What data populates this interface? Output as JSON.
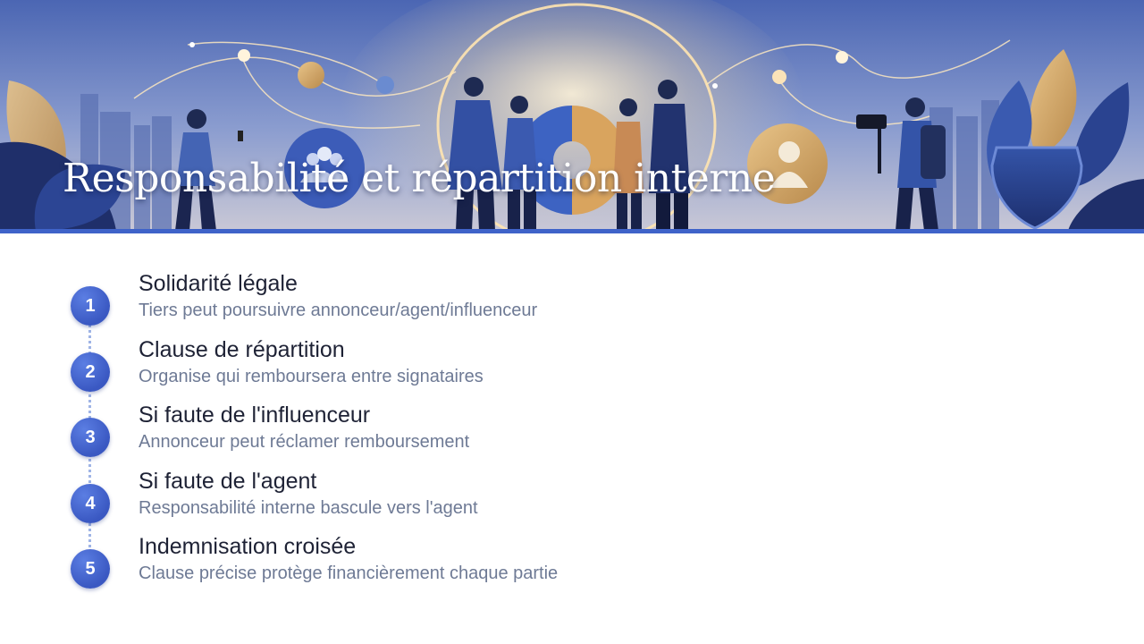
{
  "title": "Responsabilité et répartition interne",
  "accent_color": "#3f63c9",
  "banner": {
    "icons": [
      "group-people-icon",
      "user-icon",
      "puzzle-icon",
      "shield-icon",
      "camera-icon"
    ]
  },
  "steps": [
    {
      "number": "1",
      "title": "Solidarité légale",
      "description": "Tiers peut poursuivre annonceur/agent/influenceur"
    },
    {
      "number": "2",
      "title": "Clause de répartition",
      "description": "Organise qui remboursera entre signataires"
    },
    {
      "number": "3",
      "title": "Si faute de l'influenceur",
      "description": "Annonceur peut réclamer remboursement"
    },
    {
      "number": "4",
      "title": "Si faute de l'agent",
      "description": "Responsabilité interne bascule vers l'agent"
    },
    {
      "number": "5",
      "title": "Indemnisation croisée",
      "description": "Clause précise protège financièrement chaque partie"
    }
  ]
}
